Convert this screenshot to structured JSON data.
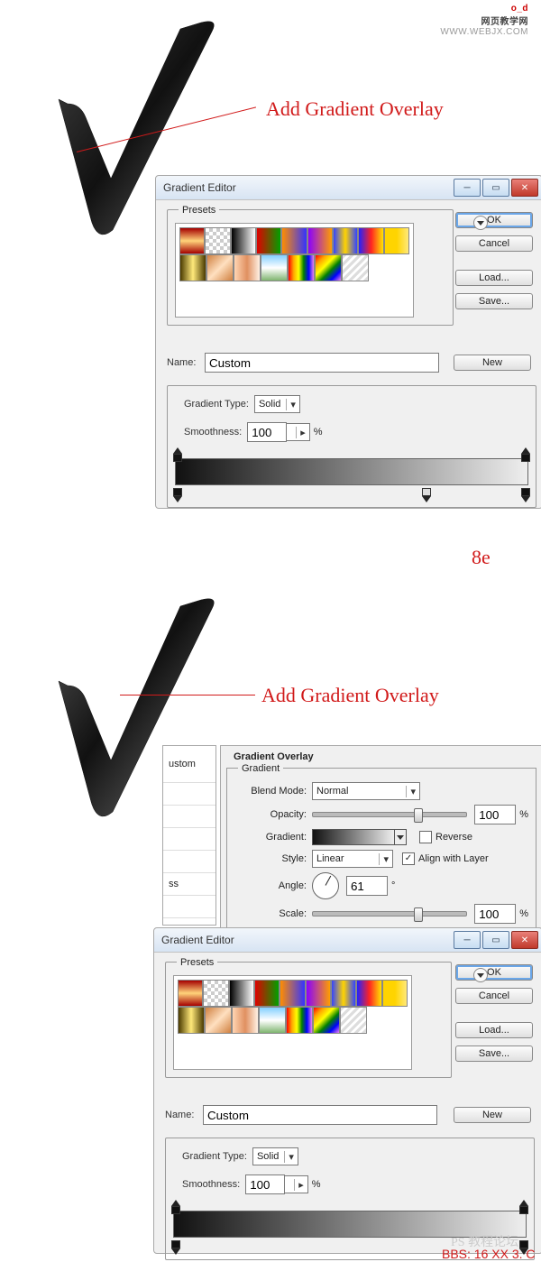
{
  "watermark": {
    "cn": "网页教学网",
    "url": "WWW.WEBJX.COM",
    "logo": "o_d"
  },
  "annotation": {
    "text": "Add Gradient Overlay"
  },
  "step_label": "8e",
  "gradient_editor": {
    "title": "Gradient Editor",
    "presets_label": "Presets",
    "name_label": "Name:",
    "name_value": "Custom",
    "type_label": "Gradient Type:",
    "type_value": "Solid",
    "smoothness_label": "Smoothness:",
    "smoothness_value": "100",
    "percent": "%",
    "buttons": {
      "ok": "OK",
      "cancel": "Cancel",
      "load": "Load...",
      "save": "Save...",
      "newbtn": "New"
    }
  },
  "gradient_overlay_panel": {
    "heading": "Gradient Overlay",
    "subheading": "Gradient",
    "blend_label": "Blend Mode:",
    "blend_value": "Normal",
    "opacity_label": "Opacity:",
    "opacity_value": "100",
    "gradient_label": "Gradient:",
    "reverse_label": "Reverse",
    "style_label": "Style:",
    "style_value": "Linear",
    "align_label": "Align with Layer",
    "angle_label": "Angle:",
    "angle_value": "61",
    "degree": "°",
    "scale_label": "Scale:",
    "scale_value": "100",
    "percent": "%"
  },
  "left_list": {
    "item1": "ustom",
    "item2": "ss"
  },
  "window_controls": {
    "min": "─",
    "max": "▭",
    "close": "✕"
  },
  "footer": {
    "forum": "PS 教程论坛",
    "bbs": "BBS: 16 XX 3. C"
  }
}
